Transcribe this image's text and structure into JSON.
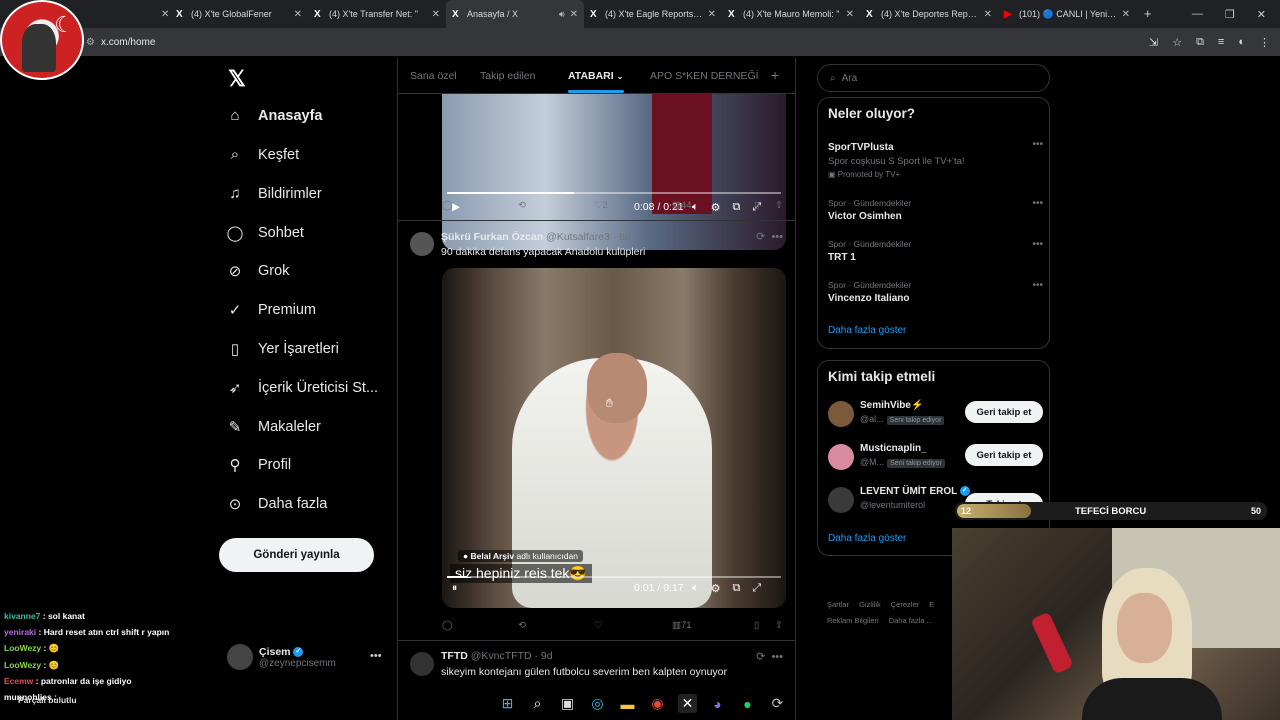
{
  "browser": {
    "tabs": [
      {
        "label": "(4) X'te GlobalFener",
        "icon": "x-icon"
      },
      {
        "label": "(4) X'te Transfer Net: \"",
        "icon": "x-icon"
      },
      {
        "label": "Anasayfa / X",
        "icon": "x-icon",
        "active": true
      },
      {
        "label": "(4) X'te Eagle Reports JK:",
        "icon": "x-icon"
      },
      {
        "label": "(4) X'te Mauro Memoli: \"",
        "icon": "x-icon"
      },
      {
        "label": "(4) X'te Deportes Reports:",
        "icon": "x-icon"
      },
      {
        "label": "(101) 🔵 CANLI | Yeni Trans",
        "icon": "youtube-icon"
      }
    ],
    "url": "x.com/home"
  },
  "nav": {
    "items": [
      {
        "label": "Anasayfa",
        "icon": "home-icon"
      },
      {
        "label": "Keşfet",
        "icon": "search-icon"
      },
      {
        "label": "Bildirimler",
        "icon": "bell-icon"
      },
      {
        "label": "Sohbet",
        "icon": "chat-icon"
      },
      {
        "label": "Grok",
        "icon": "grok-icon"
      },
      {
        "label": "Premium",
        "icon": "premium-icon"
      },
      {
        "label": "Yer İşaretleri",
        "icon": "bookmark-icon"
      },
      {
        "label": "İçerik Üreticisi St...",
        "icon": "rocket-icon"
      },
      {
        "label": "Makaleler",
        "icon": "article-icon"
      },
      {
        "label": "Profil",
        "icon": "person-icon"
      },
      {
        "label": "Daha fazla",
        "icon": "more-circle-icon"
      }
    ],
    "post_button": "Gönderi yayınla",
    "user": {
      "name": "Çisem",
      "handle": "@zeynepcisemm"
    }
  },
  "feed": {
    "tabs": [
      "Sana özel",
      "Takip edilen",
      "ATABARI",
      "APO S*KEN DERNEĞİ"
    ],
    "video1": {
      "time": "0:08 / 0:21",
      "progress": 0.38,
      "replies": "",
      "retweets": "",
      "likes": "2",
      "views": "44"
    },
    "tweet2": {
      "name": "Şükrü Furkan Özcan",
      "handle": "@Kutsalfare3 · 8d",
      "text": "90 dakika defans yapacak Anadolu kulüpleri",
      "video_source_name": "Belal Arşiv",
      "video_source_suffix": "adlı kullanıcıdan",
      "caption": "siz hepiniz reis tek😎",
      "time": "0:01 / 0:17",
      "progress": 0.06,
      "views": "71"
    },
    "tweet3": {
      "name": "TFTD",
      "handle": "@KvncTFTD · 9d",
      "text": "sikeyim kontejanı gülen futbolcu severim ben kalpten oynuyor"
    }
  },
  "sidebar": {
    "search_placeholder": "Ara",
    "trends_title": "Neler oluyor?",
    "trends": [
      {
        "category": "",
        "name": "SporTVPlusta",
        "sub": "Spor coşkusu S Sport ile TV+'ta!",
        "promo": "Promoted by TV+"
      },
      {
        "category": "Spor · Gündemdekiler",
        "name": "Victor Osimhen"
      },
      {
        "category": "Spor · Gündemdekiler",
        "name": "TRT 1"
      },
      {
        "category": "Spor · Gündemdekiler",
        "name": "Vincenzo Italiano"
      }
    ],
    "show_more": "Daha fazla göster",
    "follow_title": "Kimi takip etmeli",
    "follows": [
      {
        "name": "SemihVibe⚡",
        "handle": "@al...",
        "tag": "Seni takip ediyor",
        "button": "Geri takip et"
      },
      {
        "name": "Musticnaplin_",
        "handle": "@M...",
        "tag": "Seni takip ediyor",
        "button": "Geri takip et"
      },
      {
        "name": "LEVENT ÜMİT EROL",
        "handle": "@leventumiterol",
        "tag": "",
        "button": "Takip et"
      }
    ],
    "follow_more": "Daha fazla göster",
    "footer1": [
      "Şartlar",
      "Gizlilik",
      "Çerezler",
      "E"
    ],
    "footer2": [
      "Reklam Bilgileri",
      "Daha fazla ..."
    ]
  },
  "overlay": {
    "bar_level": "12",
    "bar_name": "TEFECİ BORCU",
    "bar_value": "50",
    "chat": [
      {
        "user": "kivanne7",
        "msg": "sol kanat"
      },
      {
        "user": "yeniraki",
        "msg": "Hard reset atın ctrl shift r yapın"
      },
      {
        "user": "LooWezy",
        "msg": "😊"
      },
      {
        "user": "LooWezy",
        "msg": "😊"
      },
      {
        "user": "Ecemw",
        "msg": "patronlar da işe gidiyo"
      },
      {
        "user": "munnohlies",
        "msg": ""
      }
    ],
    "weather": "Parçalı bulutlu"
  }
}
